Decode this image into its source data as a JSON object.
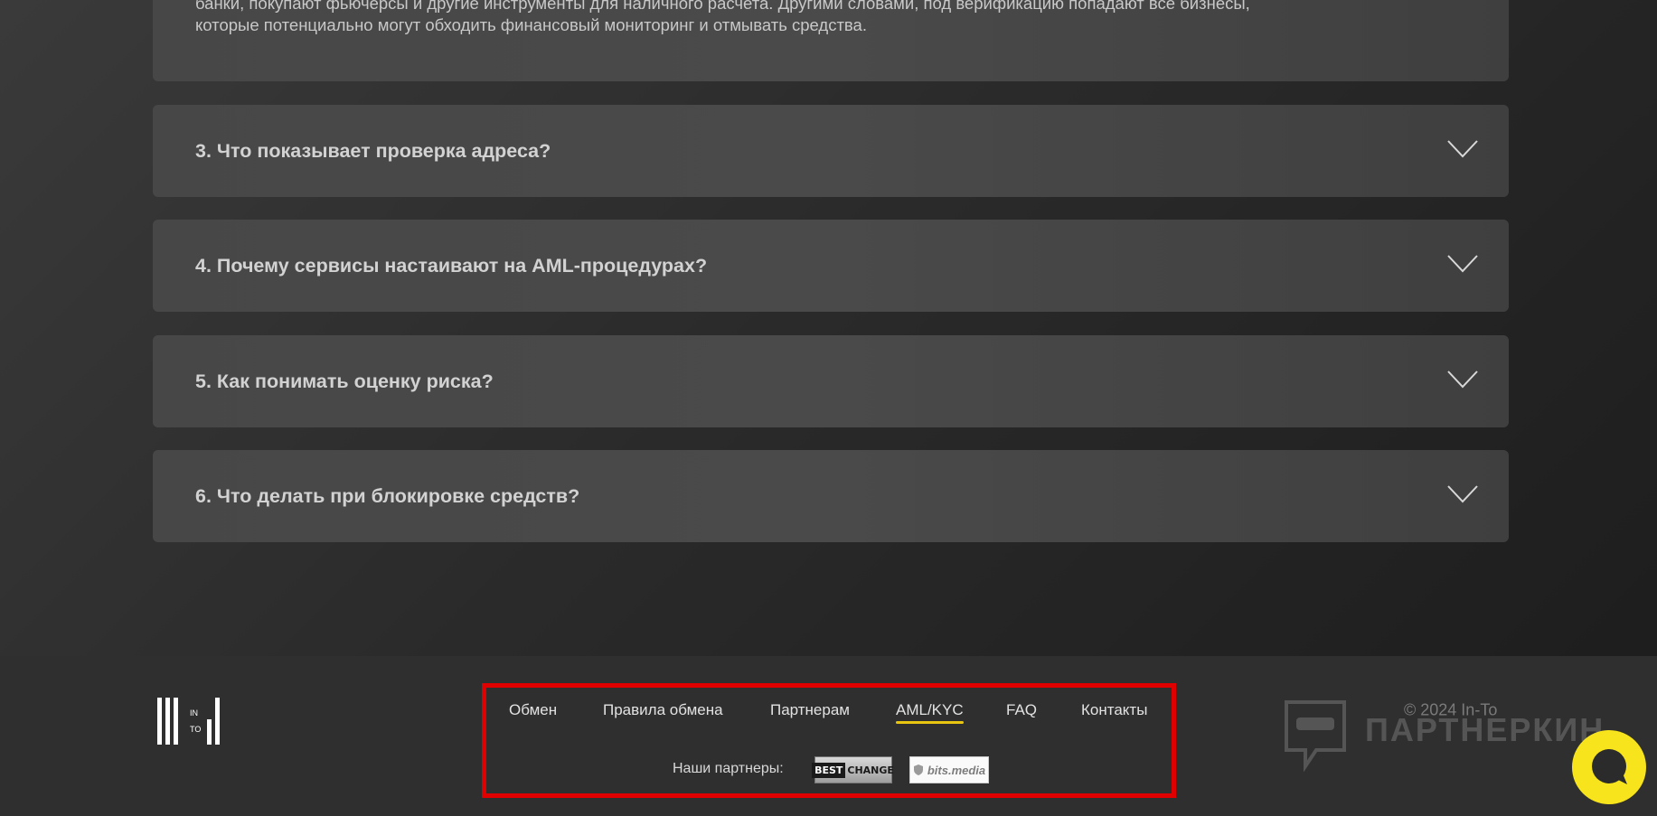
{
  "faq": {
    "open_answer_lines": [
      "банки, покупают фьючерсы и другие инструменты для наличного расчета. Другими словами, под верификацию попадают все бизнесы,",
      "которые потенциально могут обходить финансовый мониторинг и отмывать средства."
    ],
    "items": [
      {
        "question": "3. Что показывает проверка адреса?"
      },
      {
        "question": "4. Почему сервисы настаивают на AML-процедурах?"
      },
      {
        "question": "5. Как понимать оценку риска?"
      },
      {
        "question": "6. Что делать при блокировке средств?"
      }
    ]
  },
  "footer": {
    "logo_text": {
      "top": "IN",
      "bottom": "TO"
    },
    "nav": [
      {
        "label": "Обмен"
      },
      {
        "label": "Правила обмена"
      },
      {
        "label": "Партнерам"
      },
      {
        "label": "AML/KYC",
        "active": true
      },
      {
        "label": "FAQ"
      },
      {
        "label": "Контакты"
      }
    ],
    "partners_label": "Наши партнеры:",
    "partners": [
      {
        "name_part1": "BEST",
        "name_part2": "CHANGE"
      },
      {
        "name": "bits.media"
      }
    ],
    "watermark_text": "ПАРТНЕРКИН",
    "copyright": "© 2024 In-To"
  },
  "colors": {
    "accent_underline": "#e8c511",
    "chat_button": "#f7e41c",
    "highlight_border": "#e00000"
  },
  "icons": {
    "faq_toggle": "chevron-down-icon",
    "chat": "chat-bubble-icon",
    "watermark": "chat-mask-icon"
  }
}
